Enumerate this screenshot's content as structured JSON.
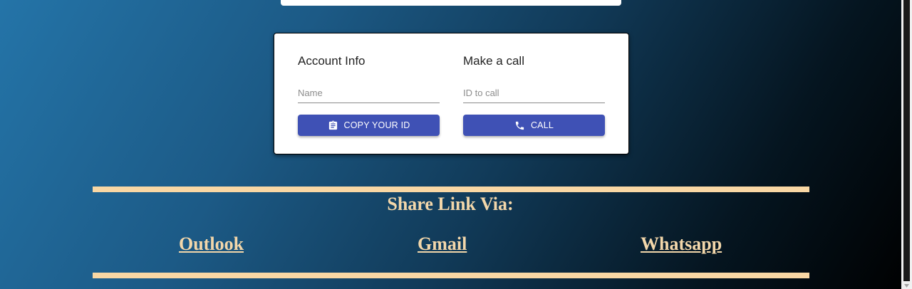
{
  "account": {
    "title": "Account Info",
    "name_placeholder": "Name",
    "copy_button_label": "COPY YOUR ID",
    "copy_icon": "clipboard-icon"
  },
  "call": {
    "title": "Make a call",
    "id_placeholder": "ID to call",
    "call_button_label": "CALL",
    "call_icon": "phone-icon"
  },
  "share": {
    "title": "Share Link Via:",
    "links": [
      {
        "label": "Outlook"
      },
      {
        "label": "Gmail"
      },
      {
        "label": "Whatsapp"
      }
    ]
  },
  "colors": {
    "button": "#3f51b5",
    "share_text": "#f3d7aa",
    "rule": "#f9d7a4"
  }
}
